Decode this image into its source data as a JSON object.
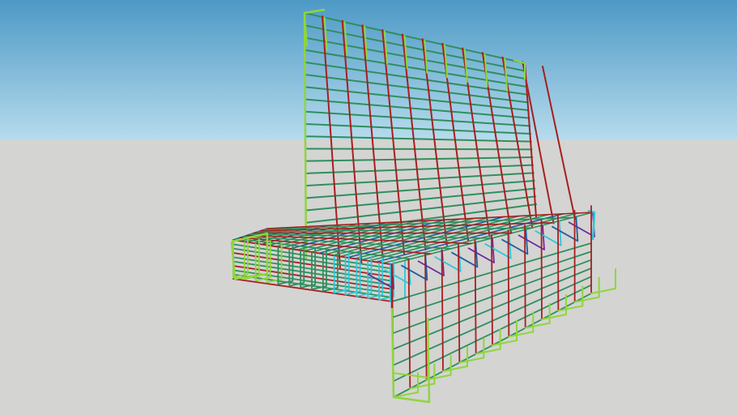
{
  "scene": {
    "subject": "rebar-cage-wall-with-l-shaped-footing",
    "colors": {
      "sky_top": "#4d99c6",
      "sky_bottom": "#b6dbec",
      "ground": "#d4d4d2",
      "rebar_red": "#a61f1f",
      "rebar_green": "#2e8f5e",
      "rebar_lime": "#8fd63a",
      "rebar_blue": "#1f5f9f",
      "rebar_cyan": "#2fc7d8",
      "rebar_purple": "#6a2aa0"
    }
  }
}
